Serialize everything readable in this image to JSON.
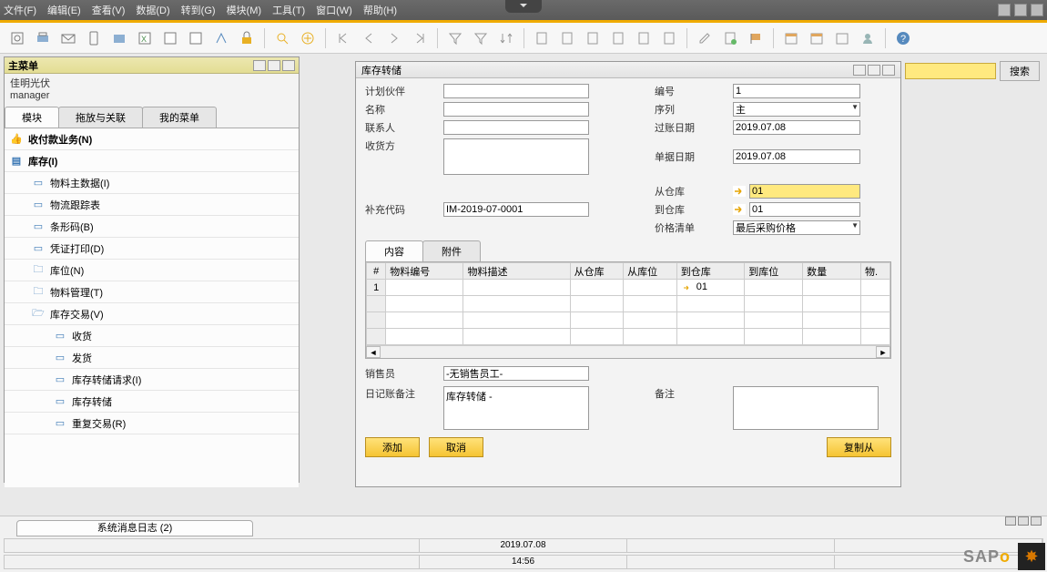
{
  "menu": {
    "items": [
      "文件(F)",
      "编辑(E)",
      "查看(V)",
      "数据(D)",
      "转到(G)",
      "模块(M)",
      "工具(T)",
      "窗口(W)",
      "帮助(H)"
    ]
  },
  "left_panel": {
    "title": "主菜单",
    "company": "佳明光伏",
    "user": "manager",
    "tabs": [
      "模块",
      "拖放与关联",
      "我的菜单"
    ],
    "tree": {
      "l1a": "收付款业务(N)",
      "l1b": "库存(I)",
      "l2_1": "物料主数据(I)",
      "l2_2": "物流跟踪表",
      "l2_3": "条形码(B)",
      "l2_4": "凭证打印(D)",
      "l2_5": "库位(N)",
      "l2_6": "物料管理(T)",
      "l2_7": "库存交易(V)",
      "l3_1": "收货",
      "l3_2": "发货",
      "l3_3": "库存转储请求(I)",
      "l3_4": "库存转储",
      "l3_5": "重复交易(R)"
    }
  },
  "form": {
    "title": "库存转储",
    "labels": {
      "partner": "计划伙伴",
      "name": "名称",
      "contact": "联系人",
      "receiver": "收货方",
      "fillcode": "补充代码",
      "no": "编号",
      "series": "序列",
      "postdate": "过账日期",
      "docdate": "单据日期",
      "fromwh": "从仓库",
      "towh": "到仓库",
      "pricelist": "价格清单",
      "sales": "销售员",
      "journal": "日记账备注",
      "remark": "备注"
    },
    "values": {
      "fillcode": "IM-2019-07-0001",
      "no": "1",
      "series": "主",
      "postdate": "2019.07.08",
      "docdate": "2019.07.08",
      "fromwh": "01",
      "towh": "01",
      "pricelist": "最后采购价格",
      "sales": "-无销售员工-",
      "journal": "库存转储 -"
    },
    "inner_tabs": [
      "内容",
      "附件"
    ],
    "columns": [
      "#",
      "物料编号",
      "物料描述",
      "从仓库",
      "从库位",
      "到仓库",
      "到库位",
      "数量",
      "物."
    ],
    "row1_towh": "01",
    "buttons": {
      "add": "添加",
      "cancel": "取消",
      "copyfrom": "复制从"
    }
  },
  "search": {
    "button": "搜索"
  },
  "status": {
    "syslog": "系统消息日志 (2)",
    "date": "2019.07.08",
    "time": "14:56"
  }
}
